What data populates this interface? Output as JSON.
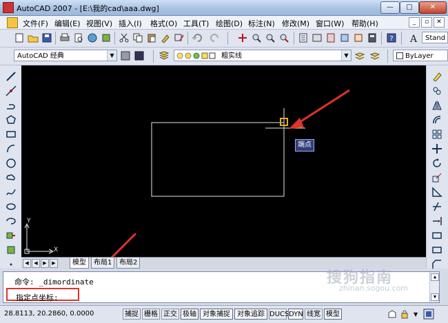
{
  "window": {
    "title": "AutoCAD 2007 - [E:\\我的cad\\aaa.dwg]",
    "minimize_label": "—",
    "maximize_label": "□",
    "close_label": "✕"
  },
  "menubar": {
    "items": [
      "文件(F)",
      "编辑(E)",
      "视图(V)",
      "插入(I)",
      "格式(O)",
      "工具(T)",
      "绘图(D)",
      "标注(N)",
      "修改(M)",
      "窗口(W)",
      "帮助(H)"
    ],
    "mdi_buttons": [
      "_",
      "▫",
      "✕"
    ]
  },
  "toolbar1": {
    "style_combo": "Stand"
  },
  "toolbar2": {
    "workspace_combo": "AutoCAD 经典",
    "layer_combo": "粗实线",
    "linetype_combo": "ByLayer"
  },
  "drawing": {
    "tooltip": "端点",
    "ucs_y": "Y",
    "ucs_x": "X"
  },
  "tabs": {
    "items": [
      "模型",
      "布局1",
      "布局2"
    ],
    "active": 0
  },
  "command": {
    "line1": "命令: _dimordinate",
    "line2": "指定点坐标:"
  },
  "statusbar": {
    "coords": "28.8113, 20.2860, 0.0000",
    "toggles": [
      "捕捉",
      "栅格",
      "正交",
      "极轴",
      "对象捕捉",
      "对象追踪",
      "DUCS",
      "DYN",
      "线宽",
      "模型"
    ]
  },
  "watermark": {
    "text": "搜狗指南",
    "url": "zhinan.sogou.com"
  },
  "colors": {
    "accent_arrow": "#e0332a",
    "highlight_box": "#e0332a",
    "canvas": "#000000",
    "tooltip_bg": "#2f3d7a"
  }
}
